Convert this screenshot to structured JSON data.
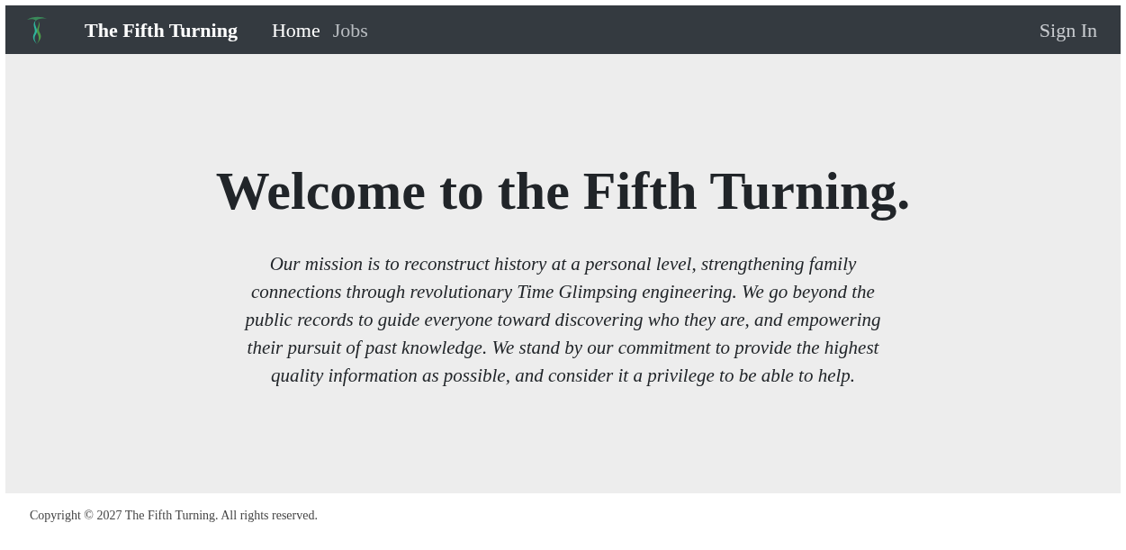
{
  "navbar": {
    "brand": "The Fifth Turning",
    "links": [
      {
        "label": "Home",
        "selected": true
      },
      {
        "label": "Jobs",
        "selected": false
      }
    ],
    "sign_in": "Sign In"
  },
  "hero": {
    "title": "Welcome to the Fifth Turning.",
    "mission": "Our mission is to reconstruct history at a personal level, strengthening family connections through revolutionary Time Glimpsing engineering. We go beyond the public records to guide everyone toward discovering who they are, and empowering their pursuit of past knowledge. We stand by our commitment to provide the highest quality information as possible, and consider it a privilege to be able to help."
  },
  "footer": {
    "copyright": "Copyright © 2027 The Fifth Turning. All rights reserved."
  }
}
